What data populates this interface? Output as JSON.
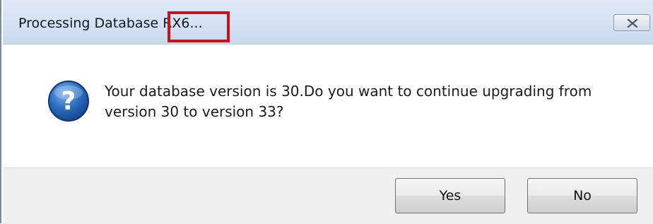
{
  "window": {
    "title": "Processing Database RX6...",
    "close_icon": "close-icon"
  },
  "message": {
    "icon": "question-icon",
    "text": "Your database version is 30.Do you want to continue upgrading from version 30 to version 33?"
  },
  "buttons": {
    "yes_label": "Yes",
    "no_label": "No"
  },
  "colors": {
    "highlight_box": "#c0151b",
    "titlebar": "#d6e3f3",
    "question_icon": "#1f5fae"
  }
}
